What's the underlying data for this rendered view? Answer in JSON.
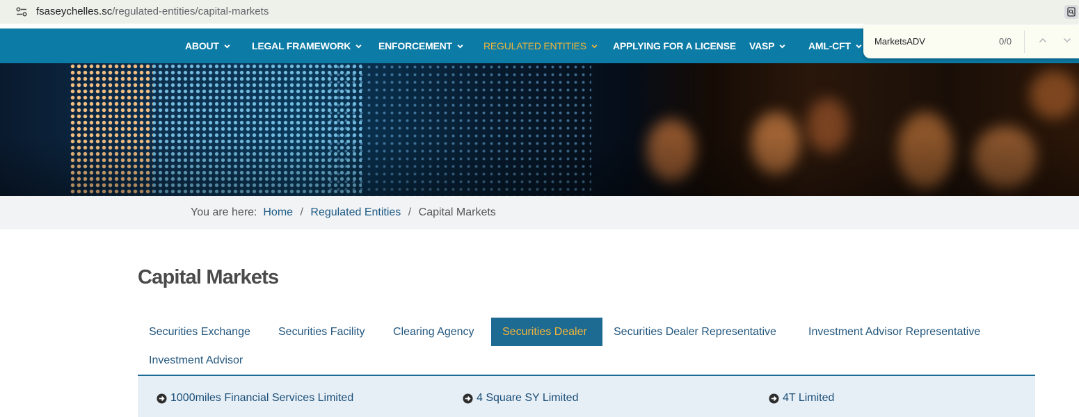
{
  "browser": {
    "url_host": "fsaseychelles.sc",
    "url_path": "/regulated-entities/capital-markets",
    "site_info_icon": "tune-icon",
    "lens_icon": "page-search-icon"
  },
  "nav": {
    "items": [
      {
        "label": "ABOUT",
        "dropdown": true
      },
      {
        "label": "LEGAL FRAMEWORK",
        "dropdown": true
      },
      {
        "label": "ENFORCEMENT",
        "dropdown": true
      },
      {
        "label": "REGULATED ENTITIES",
        "dropdown": true,
        "active": true
      },
      {
        "label": "APPLYING FOR A LICENSE",
        "dropdown": false
      },
      {
        "label": "VASP",
        "dropdown": true
      },
      {
        "label": "AML-CFT",
        "dropdown": true
      }
    ],
    "active_color": "#f0b63a",
    "background": "#0c7ba6"
  },
  "find_bar": {
    "query": "MarketsADV",
    "count": "0/0"
  },
  "breadcrumb": {
    "prefix": "You are here:",
    "items": [
      "Home",
      "Regulated Entities",
      "Capital Markets"
    ],
    "separator": "/"
  },
  "page": {
    "title": "Capital Markets"
  },
  "tabs": [
    {
      "label": "Securities Exchange"
    },
    {
      "label": "Securities Facility"
    },
    {
      "label": "Clearing Agency"
    },
    {
      "label": "Securities Dealer",
      "active": true
    },
    {
      "label": "Securities Dealer Representative"
    },
    {
      "label": "Investment Advisor Representative"
    },
    {
      "label": "Investment Advisor"
    }
  ],
  "entities": [
    {
      "name": "1000miles Financial Services Limited",
      "icon": "arrow-circle-right-icon"
    },
    {
      "name": "4 Square SY Limited",
      "icon": "arrow-circle-right-icon"
    },
    {
      "name": "4T Limited",
      "icon": "arrow-circle-right-icon"
    }
  ]
}
